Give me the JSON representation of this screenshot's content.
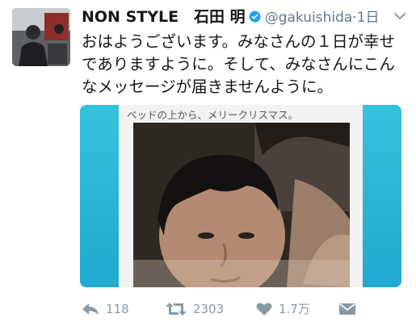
{
  "tweet": {
    "name": "NON STYLE　石田 明",
    "handle": "@gakuishida",
    "separator": "·",
    "time": "1日",
    "text": "おはようございます。みなさんの１日が幸せでありますように。そして、みなさんにこんなメッセージが届きませんように。",
    "media_caption": "ベッドの上から、メリークリスマス。"
  },
  "actions": {
    "replies": "118",
    "retweets": "2303",
    "likes": "1.7万"
  },
  "icons": {
    "verified": "verified-badge-icon",
    "reply": "reply-icon",
    "retweet": "retweet-icon",
    "like": "heart-icon",
    "dm": "direct-message-icon",
    "menu": "chevron-down-icon"
  },
  "colors": {
    "accent": "#1da1f2",
    "muted": "#8899a6",
    "media_bg": "#2bb7d8"
  }
}
